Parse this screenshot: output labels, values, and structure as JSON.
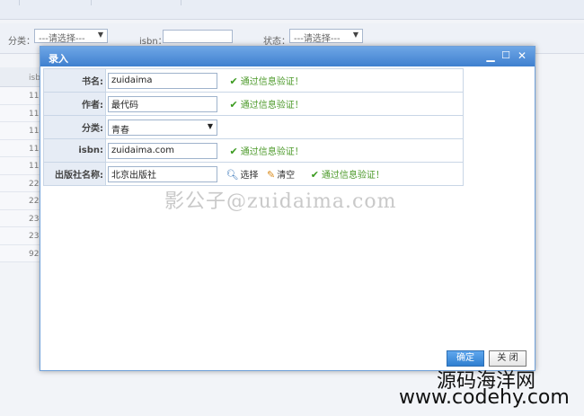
{
  "filter": {
    "category_label": "分类：",
    "category_value": "---请选择---",
    "isbn_label": "isbn：",
    "status_label": "状态：",
    "status_value": "---请选择---"
  },
  "grid": {
    "header": "isb",
    "rows": [
      "11",
      "11",
      "11",
      "11",
      "11",
      "22",
      "22",
      "23",
      "23",
      "92"
    ]
  },
  "dialog": {
    "title": "录入",
    "fields": [
      {
        "label": "书名:",
        "value": "zuidaima",
        "status": "通过信息验证！"
      },
      {
        "label": "作者:",
        "value": "最代码",
        "status": "通过信息验证！"
      },
      {
        "label": "分类:",
        "value": "青春"
      },
      {
        "label": "isbn:",
        "value": "zuidaima.com",
        "status": "通过信息验证！"
      },
      {
        "label": "出版社名称:",
        "value": "北京出版社",
        "select_label": "选择",
        "clear_label": "清空",
        "status": "通过信息验证！"
      }
    ],
    "watermark": "影公子@zuidaima.com",
    "confirm_label": "确定",
    "close_label": "关 闭"
  },
  "branding": {
    "line1": "源码海洋网",
    "line2": "www.codehy.com"
  },
  "colors": {
    "title_bar": "#3f80cf",
    "success": "#4c9a2a",
    "confirm_button": "#2f7fd0"
  }
}
